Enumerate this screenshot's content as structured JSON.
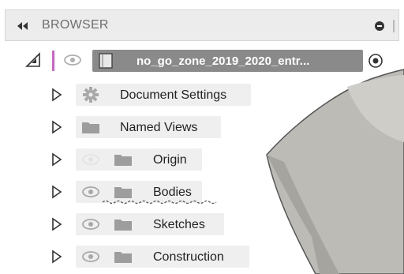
{
  "browser": {
    "title": "BROWSER"
  },
  "root": {
    "name": "no_go_zone_2019_2020_entr..."
  },
  "tree": [
    {
      "label": "Document Settings",
      "icon": "gear-icon",
      "eye": false
    },
    {
      "label": "Named Views",
      "icon": "folder-icon",
      "eye": false
    },
    {
      "label": "Origin",
      "icon": "folder-icon",
      "eye": "hidden"
    },
    {
      "label": "Bodies",
      "icon": "folder-icon",
      "eye": true
    },
    {
      "label": "Sketches",
      "icon": "folder-icon",
      "eye": true
    },
    {
      "label": "Construction",
      "icon": "folder-icon",
      "eye": true
    }
  ],
  "colors": {
    "root_bar": "#8a8a8a",
    "active_accent": "#d35fd0",
    "header_bg": "#ececec",
    "viewport_body": "#bdbbb5"
  }
}
